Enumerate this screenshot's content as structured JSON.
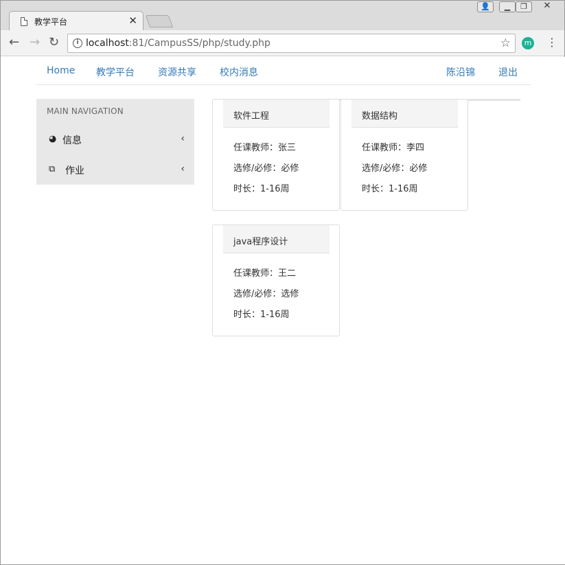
{
  "browser": {
    "tab_title": "教学平台",
    "url_host": "localhost",
    "url_rest": ":81/CampusSS/php/study.php",
    "avatar_letter": "m",
    "accent_color": "#1ab394"
  },
  "nav": {
    "home": "Home",
    "teaching": "教学平台",
    "resources": "资源共享",
    "messages": "校内消息",
    "user": "陈沿锦",
    "logout": "退出",
    "link_color": "#337ab7"
  },
  "sidebar": {
    "header": "MAIN NAVIGATION",
    "items": [
      {
        "label": "信息",
        "icon": "dashboard-icon"
      },
      {
        "label": "作业",
        "icon": "copy-icon"
      }
    ]
  },
  "courses": [
    {
      "title": "软件工程",
      "teacher": "任课教师：张三",
      "type": "选修/必修：必修",
      "duration": "时长：1-16周"
    },
    {
      "title": "数据结构",
      "teacher": "任课教师：李四",
      "type": "选修/必修：必修",
      "duration": "时长：1-16周"
    },
    {
      "title": "java程序设计",
      "teacher": "任课教师：王二",
      "type": "选修/必修：选修",
      "duration": "时长：1-16周"
    }
  ]
}
